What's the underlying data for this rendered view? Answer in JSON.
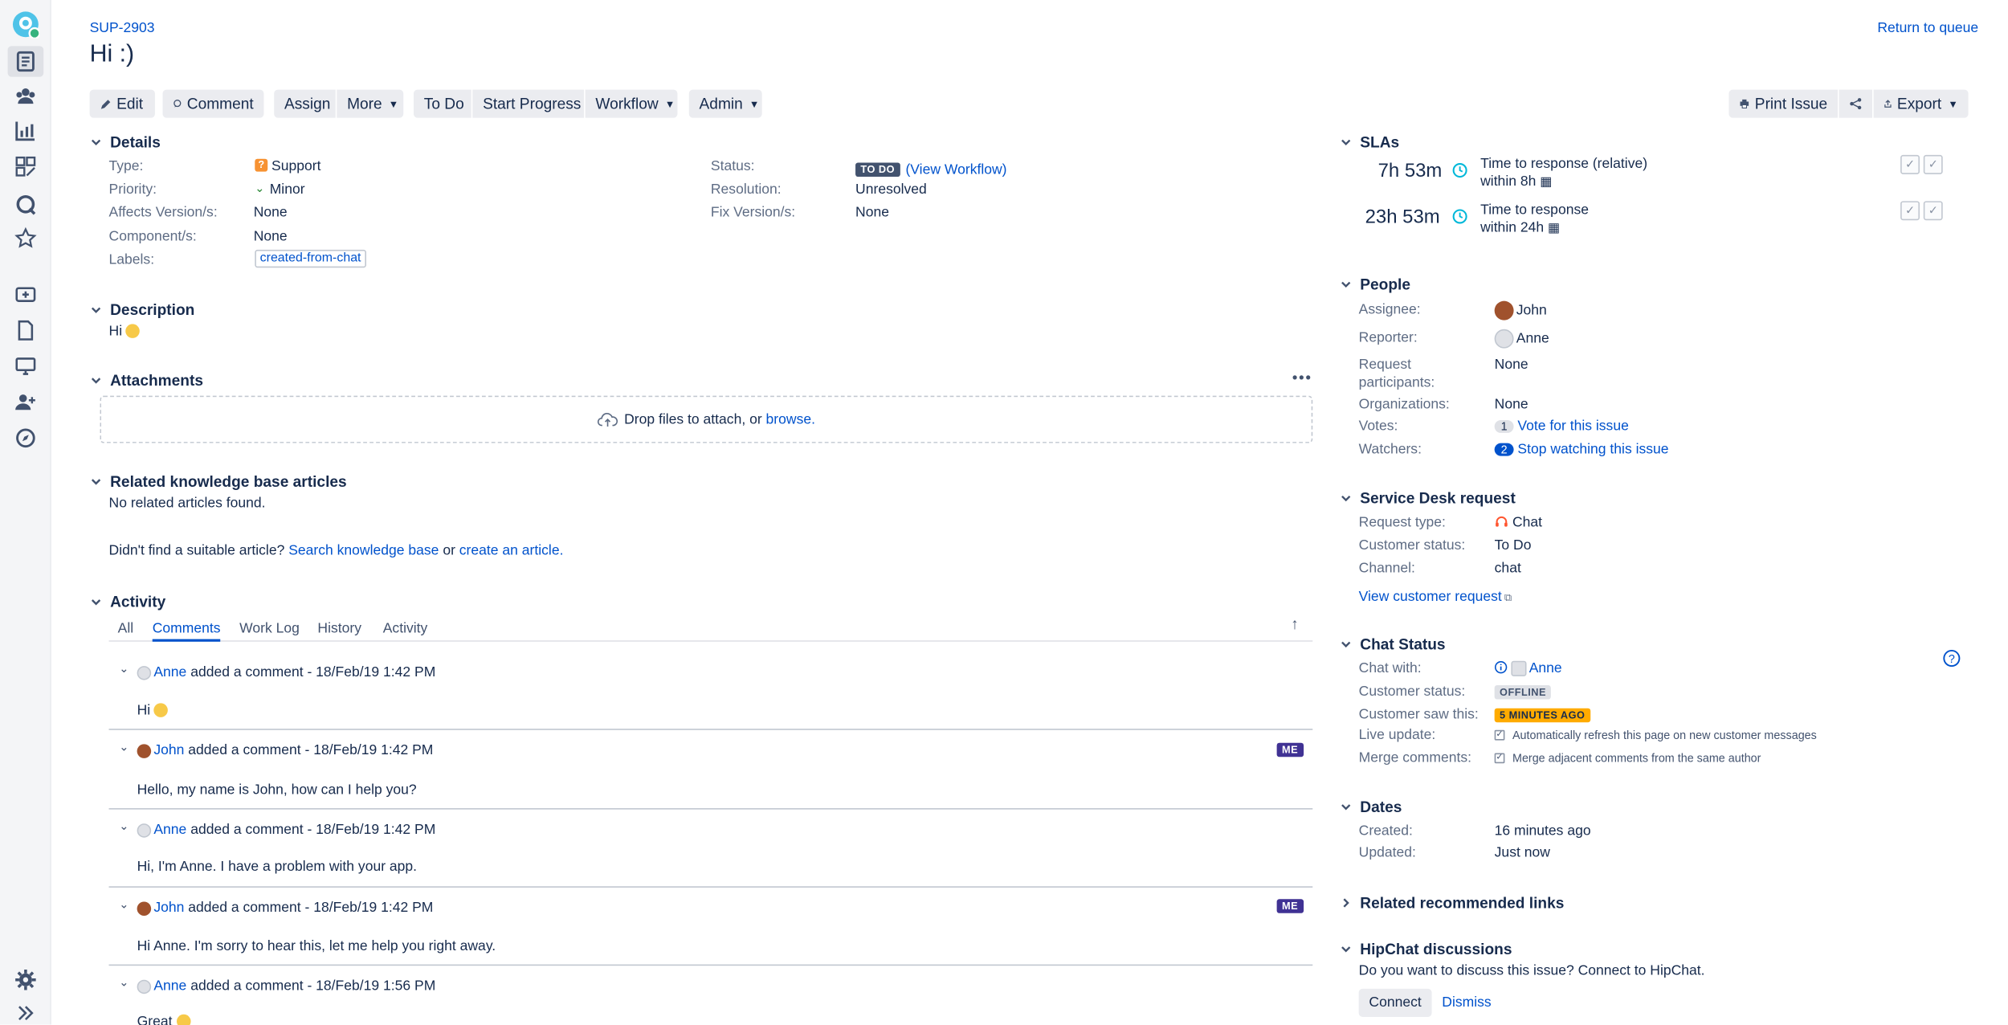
{
  "issue": {
    "key": "SUP-2903",
    "title": "Hi :)",
    "return_link": "Return to queue"
  },
  "toolbar": {
    "edit": "Edit",
    "comment": "Comment",
    "assign": "Assign",
    "more": "More",
    "todo": "To Do",
    "start_progress": "Start Progress",
    "workflow": "Workflow",
    "admin": "Admin",
    "print_issue": "Print Issue",
    "export": "Export"
  },
  "details": {
    "heading": "Details",
    "type_label": "Type:",
    "type_value": "Support",
    "priority_label": "Priority:",
    "priority_value": "Minor",
    "affects_label": "Affects Version/s:",
    "affects_value": "None",
    "component_label": "Component/s:",
    "component_value": "None",
    "labels_label": "Labels:",
    "labels_value": "created-from-chat",
    "status_label": "Status:",
    "status_badge": "TO DO",
    "status_link": "(View Workflow)",
    "resolution_label": "Resolution:",
    "resolution_value": "Unresolved",
    "fix_label": "Fix Version/s:",
    "fix_value": "None"
  },
  "description": {
    "heading": "Description",
    "text": "Hi"
  },
  "attachments": {
    "heading": "Attachments",
    "drop_text": "Drop files to attach, or",
    "browse": "browse."
  },
  "kb": {
    "heading": "Related knowledge base articles",
    "none": "No related articles found.",
    "prompt": "Didn't find a suitable article?",
    "search_link": "Search knowledge base",
    "or": "or",
    "create_link": "create an article."
  },
  "activity": {
    "heading": "Activity",
    "tabs": [
      "All",
      "Comments",
      "Work Log",
      "History",
      "Activity"
    ],
    "comments": [
      {
        "author": "Anne",
        "meta": "added a comment - 18/Feb/19 1:42 PM",
        "body": "Hi",
        "me": ""
      },
      {
        "author": "John",
        "meta": "added a comment - 18/Feb/19 1:42 PM",
        "body": "Hello, my name is John, how can I help you?",
        "me": "ME"
      },
      {
        "author": "Anne",
        "meta": "added a comment - 18/Feb/19 1:42 PM",
        "body": "Hi, I'm Anne. I have a problem with your app.",
        "me": ""
      },
      {
        "author": "John",
        "meta": "added a comment - 18/Feb/19 1:42 PM",
        "body": "Hi Anne. I'm sorry to hear this, let me help you right away.",
        "me": "ME"
      },
      {
        "author": "Anne",
        "meta": "added a comment - 18/Feb/19 1:56 PM",
        "body": "Great",
        "me": ""
      }
    ]
  },
  "slas": {
    "heading": "SLAs",
    "items": [
      {
        "time": "7h 53m",
        "name": "Time to response (relative)",
        "within": "within 8h"
      },
      {
        "time": "23h 53m",
        "name": "Time to response",
        "within": "within 24h"
      }
    ]
  },
  "people": {
    "heading": "People",
    "assignee_label": "Assignee:",
    "assignee": "John",
    "reporter_label": "Reporter:",
    "reporter": "Anne",
    "participants_label_1": "Request",
    "participants_label_2": "participants:",
    "participants": "None",
    "orgs_label": "Organizations:",
    "orgs": "None",
    "votes_label": "Votes:",
    "votes_count": "1",
    "votes_link": "Vote for this issue",
    "watchers_label": "Watchers:",
    "watchers_count": "2",
    "watchers_link": "Stop watching this issue"
  },
  "sd": {
    "heading": "Service Desk request",
    "type_label": "Request type:",
    "type": "Chat",
    "cust_label": "Customer status:",
    "cust": "To Do",
    "channel_label": "Channel:",
    "channel": "chat",
    "view_link": "View customer request"
  },
  "chat": {
    "heading": "Chat Status",
    "with_label": "Chat with:",
    "with": "Anne",
    "cust_label": "Customer status:",
    "cust_badge": "OFFLINE",
    "saw_label": "Customer saw this:",
    "saw_badge": "5 MINUTES AGO",
    "live_label": "Live update:",
    "live_text": "Automatically refresh this page on new customer messages",
    "merge_label": "Merge comments:",
    "merge_text": "Merge adjacent comments from the same author"
  },
  "dates": {
    "heading": "Dates",
    "created_label": "Created:",
    "created": "16 minutes ago",
    "updated_label": "Updated:",
    "updated": "Just now"
  },
  "links": {
    "heading": "Related recommended links"
  },
  "hipchat": {
    "heading": "HipChat discussions",
    "prompt": "Do you want to discuss this issue? Connect to HipChat.",
    "connect": "Connect",
    "dismiss": "Dismiss"
  },
  "colors": {
    "link": "#0052cc",
    "text": "#172b4d",
    "muted": "#5e6c84",
    "me_badge": "#403294",
    "saw_badge": "#ffab00",
    "status_badge": "#42526e"
  }
}
